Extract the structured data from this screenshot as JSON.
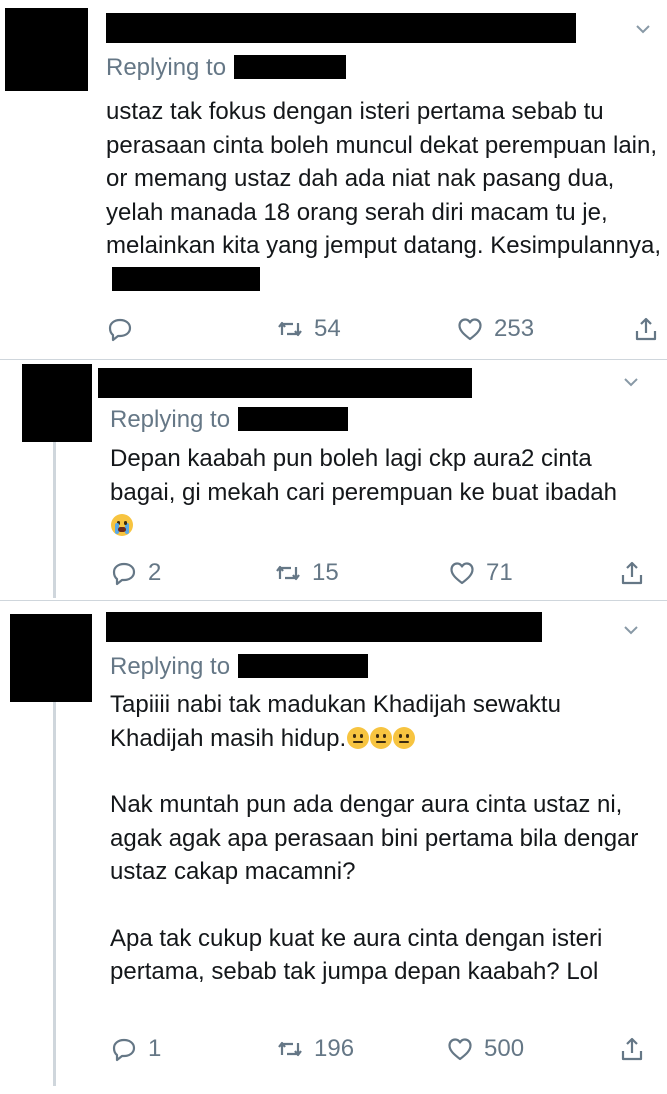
{
  "icons": {
    "chevron": "chevron-down-icon",
    "reply": "reply-icon",
    "retweet": "retweet-icon",
    "like": "heart-icon",
    "share": "share-icon"
  },
  "colors": {
    "muted": "#657786",
    "text": "#14171a",
    "divider": "#cfd6dc"
  },
  "tweets": [
    {
      "replying_label": "Replying to",
      "body": "ustaz tak fokus dengan isteri pertama sebab tu perasaan cinta boleh muncul dekat perempuan lain, or memang ustaz dah ada niat nak pasang dua, yelah manada 18 orang serah diri macam tu je, melainkan kita yang jemput datang. Kesimpulannya,",
      "reply_count": "",
      "retweet_count": "54",
      "like_count": "253"
    },
    {
      "replying_label": "Replying to",
      "body": "Depan kaabah pun boleh lagi ckp aura2 cinta bagai, gi mekah cari perempuan ke buat ibadah",
      "reply_count": "2",
      "retweet_count": "15",
      "like_count": "71"
    },
    {
      "replying_label": "Replying to",
      "paragraphs": [
        "Tapiiii nabi tak madukan Khadijah sewaktu Khadijah masih hidup.",
        "Nak muntah pun ada dengar aura cinta ustaz ni, agak agak apa perasaan bini pertama bila dengar ustaz cakap macamni?",
        "Apa tak cukup kuat ke aura cinta dengan isteri pertama, sebab tak jumpa depan kaabah? Lol"
      ],
      "reply_count": "1",
      "retweet_count": "196",
      "like_count": "500"
    }
  ]
}
